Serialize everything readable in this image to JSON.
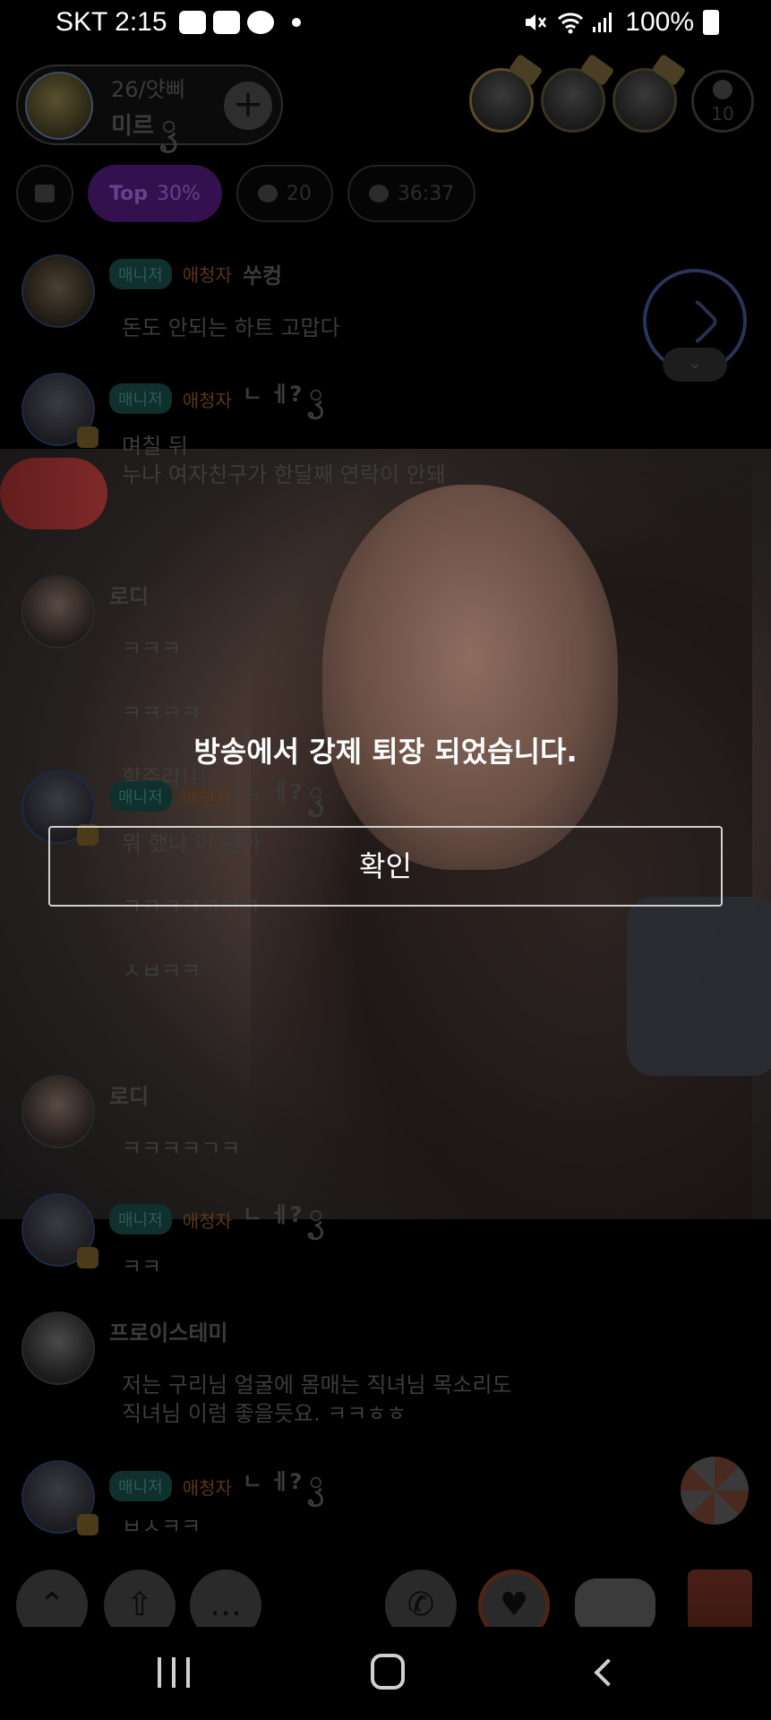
{
  "status_bar": {
    "carrier_time": "SKT 2:15",
    "battery": "100%",
    "notification_icons": [
      "spoon-icon",
      "gallery-icon",
      "messenger-icon"
    ],
    "status_icons": [
      "mute-icon",
      "wifi-icon",
      "signal-icon",
      "battery-icon"
    ]
  },
  "header": {
    "host_channel": "26/얏삐",
    "host_name": "미르 ꦽ",
    "listener_count": "10"
  },
  "chips": {
    "top_label": "Top",
    "top_value": "30%",
    "likes": "20",
    "duration": "36:37"
  },
  "chat": {
    "messages": [
      {
        "tag_manager": "매니저",
        "tag_fan": "애청자",
        "nick": "쑤컹",
        "lines": [
          "돈도 안되는 하트 고맙다"
        ]
      },
      {
        "tag_manager": "매니저",
        "tag_fan": "애청자",
        "nick": "ㄴ ㅔ? ꦽ",
        "lines": [
          "며칠 뒤",
          "누나 여자친구가 한달째 연락이 안돼"
        ]
      },
      {
        "nick": "로디",
        "lines": [
          "ㅋㅋㅋ",
          "ㅋㅋㅋㅋ",
          "함주라!!!"
        ]
      },
      {
        "tag_manager": "매니저",
        "tag_fan": "애청자",
        "nick": "ㄴ ㅔ? ꦽ",
        "lines": [
          "뭐 했냐 이 년아",
          "ㅋㅋㅋㅋㅋㅋㅋ",
          "ㅅㅂㅋㅋ"
        ]
      },
      {
        "nick": "로디",
        "lines": [
          "ㅋㅋㅋㅋㄱㅋ"
        ]
      },
      {
        "tag_manager": "매니저",
        "tag_fan": "애청자",
        "nick": "ㄴ ㅔ? ꦽ",
        "lines": [
          "ㅋㅋ"
        ]
      },
      {
        "nick": "프로이스테미",
        "lines": [
          "저는 구리님 얼굴에 몸매는 직녀님 목소리도",
          "직녀님 이럼 좋을듯요. ㅋㅋㅎㅎ"
        ]
      },
      {
        "tag_manager": "매니저",
        "tag_fan": "애청자",
        "nick": "ㄴ ㅔ? ꦽ",
        "lines": [
          "ㅂㅅㅋㅋ"
        ]
      }
    ]
  },
  "dialog": {
    "message": "방송에서 강제 퇴장 되었습니다.",
    "confirm_label": "확인"
  },
  "toolbar": {
    "icons": [
      "chevron-up-icon",
      "share-icon",
      "chat-icon",
      "phone-icon",
      "heart-icon",
      "gamepad-icon",
      "gift-icon",
      "roulette-icon"
    ]
  }
}
